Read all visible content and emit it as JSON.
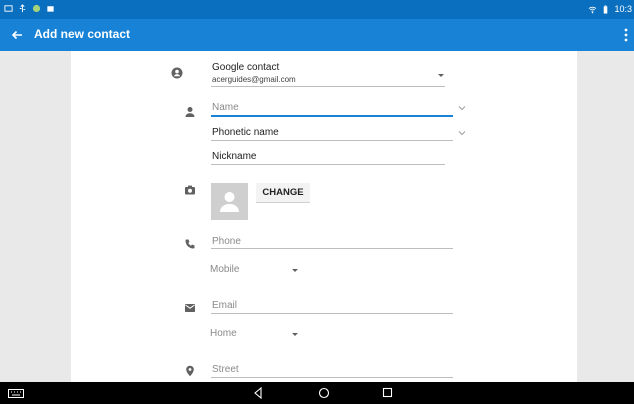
{
  "statusbar": {
    "time": "10:3"
  },
  "appbar": {
    "title": "Add new contact"
  },
  "account": {
    "type_label": "Google contact",
    "email": "acerguides@gmail.com"
  },
  "fields": {
    "name_placeholder": "Name",
    "phonetic_placeholder": "Phonetic name",
    "nickname_placeholder": "Nickname",
    "phone_placeholder": "Phone",
    "phone_type": "Mobile",
    "email_placeholder": "Email",
    "email_type": "Home",
    "street_placeholder": "Street"
  },
  "photo": {
    "change_label": "CHANGE"
  },
  "colors": {
    "statusbar": "#0a6fbf",
    "appbar": "#1782d6",
    "accent": "#1782d6"
  }
}
